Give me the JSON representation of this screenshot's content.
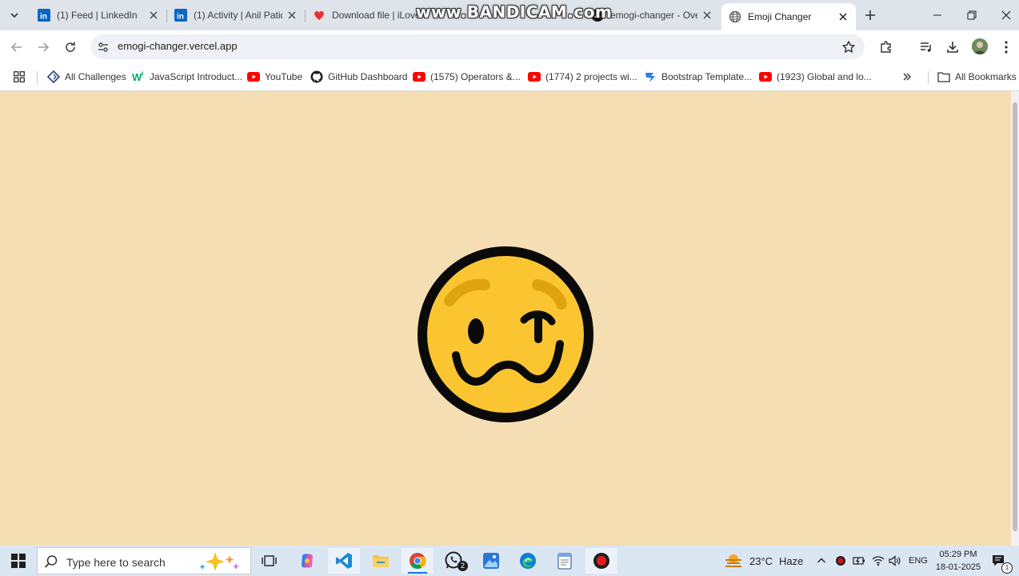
{
  "tabs": [
    {
      "title": "(1) Feed | LinkedIn",
      "icon": "linkedin-icon"
    },
    {
      "title": "(1) Activity | Anil Patid",
      "icon": "linkedin-icon"
    },
    {
      "title": "Download file | iLoveP",
      "icon": "ilovepdf-heart-icon"
    },
    {
      "title": "emogi-changer - Ove",
      "icon": "vercel-icon"
    },
    {
      "title": "Emoji Changer",
      "icon": "globe-icon",
      "active": true
    }
  ],
  "watermark": "www.BANDICAM.com",
  "omnibox": {
    "url": "emogi-changer.vercel.app"
  },
  "bookmarks": [
    {
      "label": "All Challenges",
      "icon": "challenges-icon"
    },
    {
      "label": "JavaScript Introduct...",
      "icon": "w3schools-icon"
    },
    {
      "label": "YouTube",
      "icon": "youtube-icon"
    },
    {
      "label": "GitHub Dashboard",
      "icon": "github-icon"
    },
    {
      "label": "(1575) Operators &...",
      "icon": "youtube-icon"
    },
    {
      "label": "(1774) 2 projects wi...",
      "icon": "youtube-icon"
    },
    {
      "label": "Bootstrap Template...",
      "icon": "bootstrap-icon"
    },
    {
      "label": "(1923) Global and lo...",
      "icon": "youtube-icon"
    }
  ],
  "all_bookmarks": "All Bookmarks",
  "content": {
    "emoji": "woozy-face",
    "background": "#f5deb3",
    "emoji_fill": "#fbc531"
  },
  "taskbar": {
    "search_placeholder": "Type here to search",
    "whatsapp_badge": "2",
    "weather": {
      "temp": "23°C",
      "condition": "Haze"
    },
    "language": "ENG",
    "time": "05:29 PM",
    "date": "18-01-2025",
    "notification_count": "1"
  }
}
